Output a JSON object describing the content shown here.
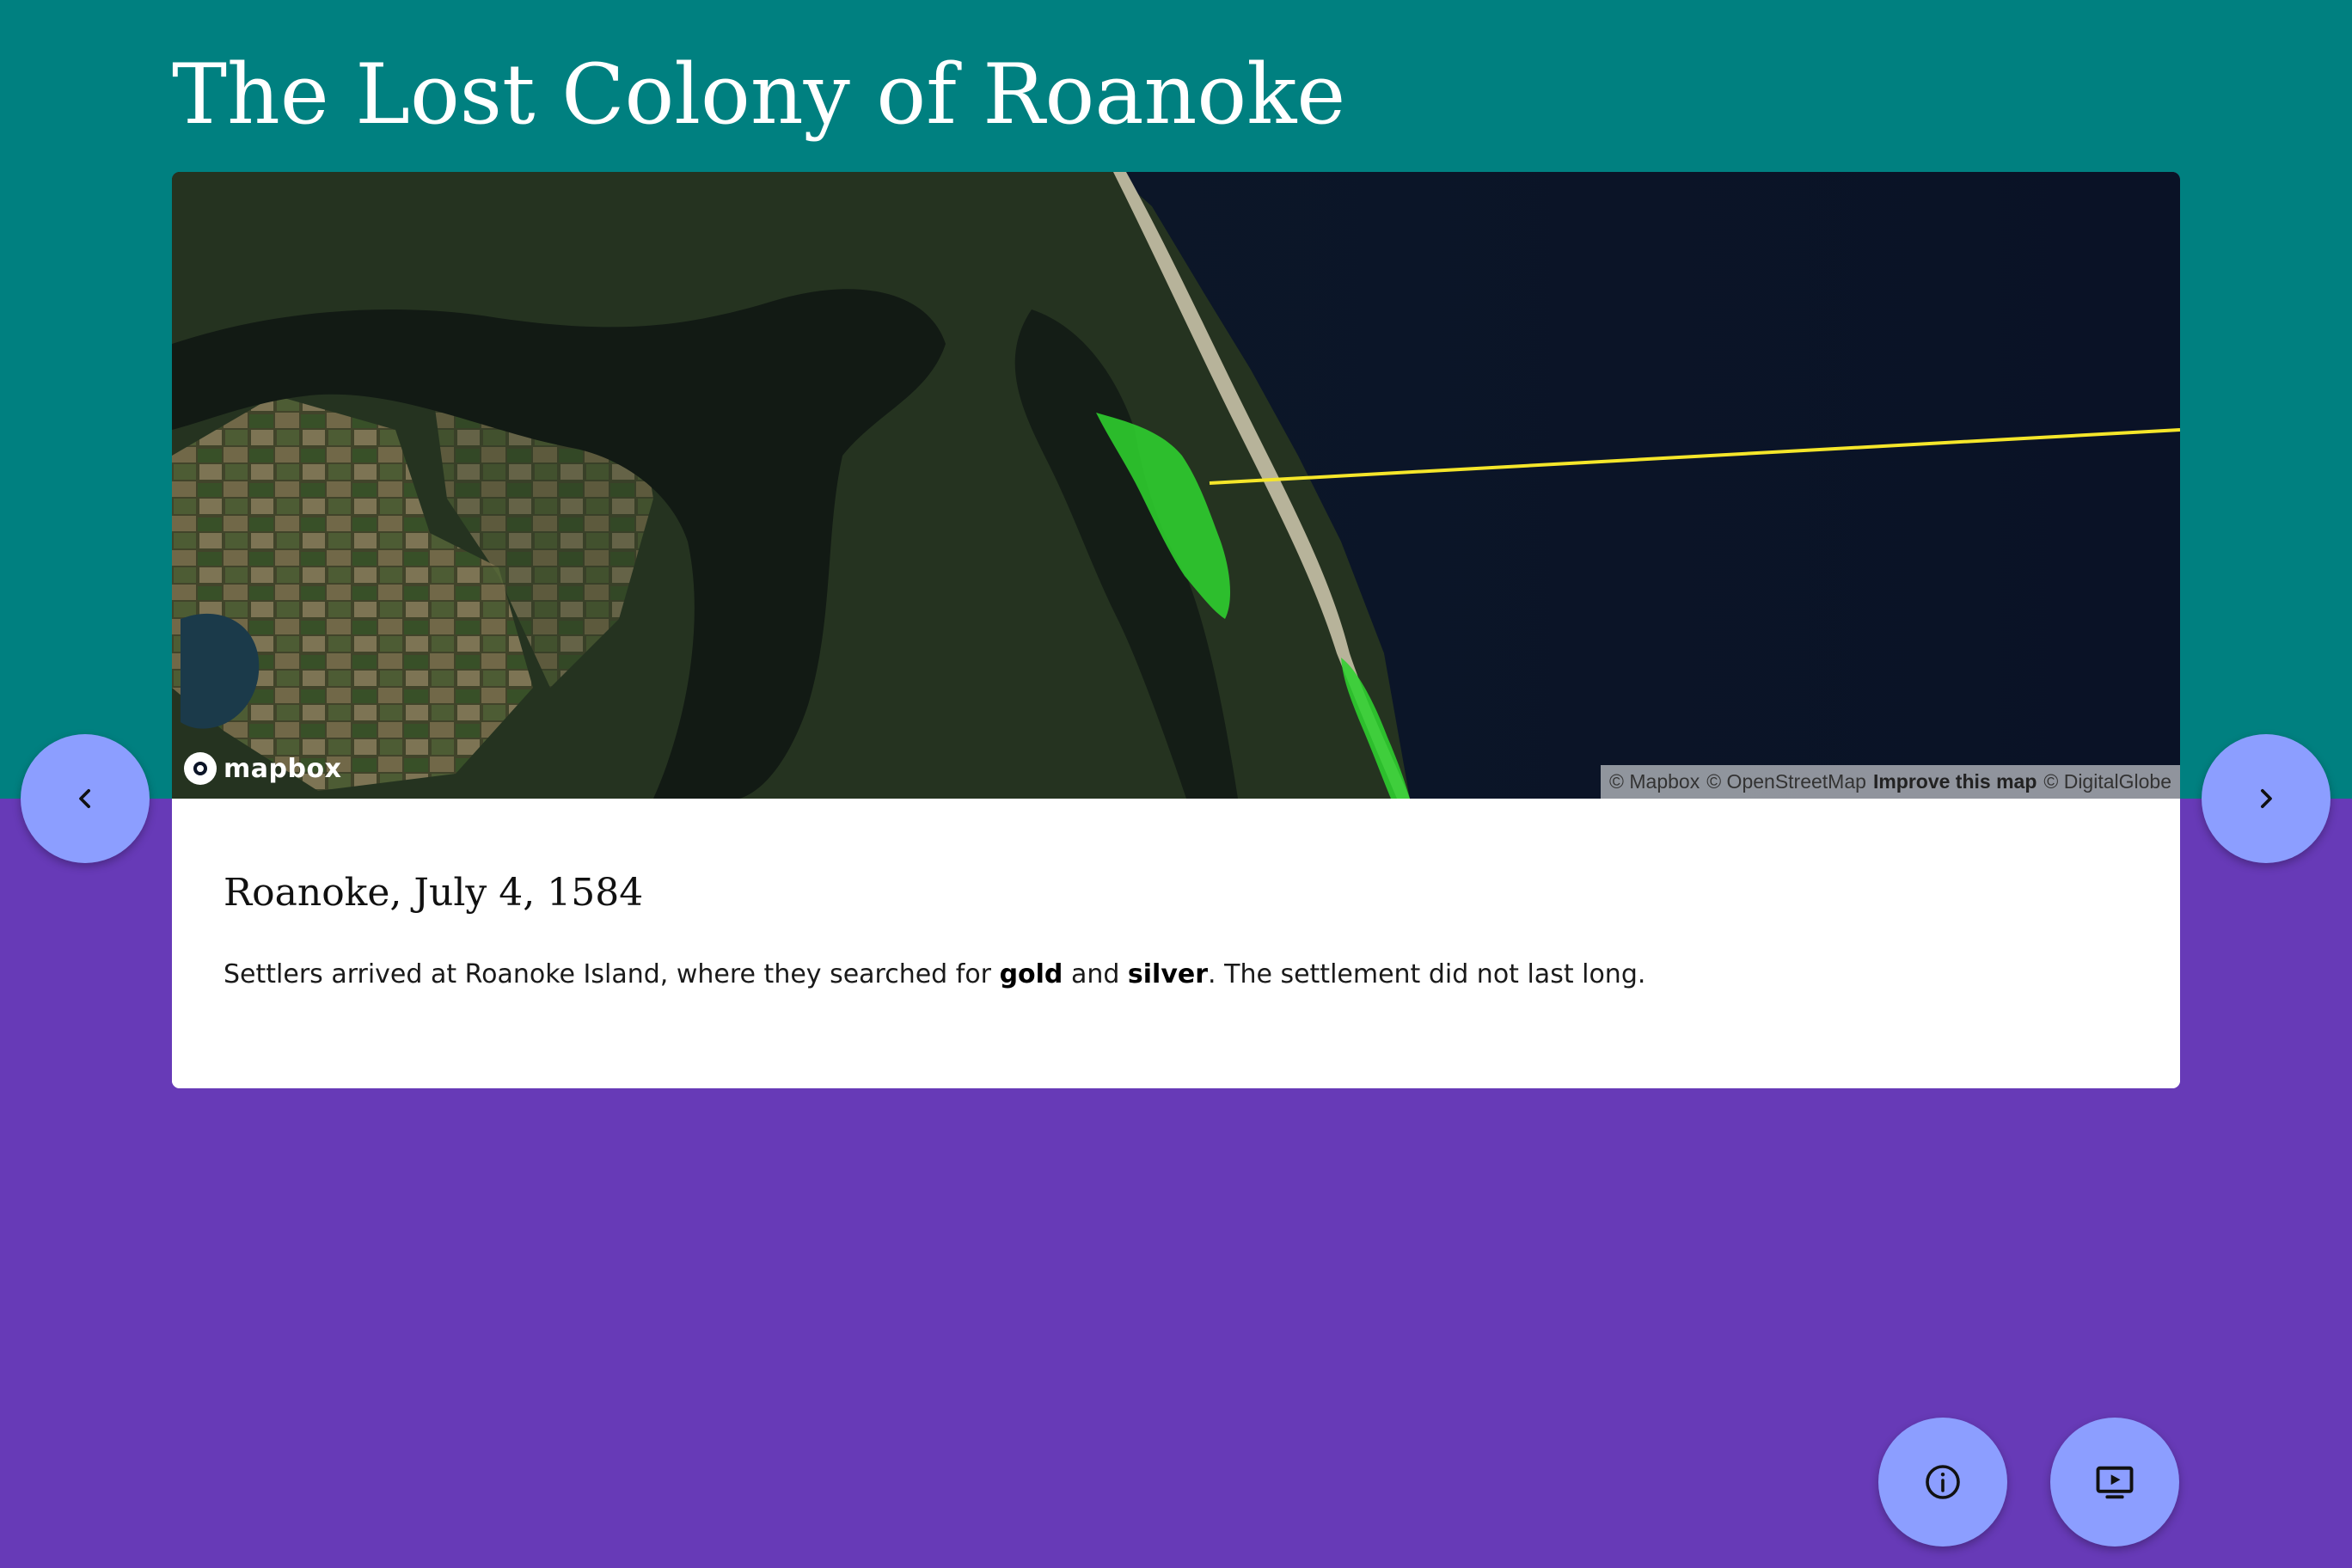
{
  "header": {
    "title": "The Lost Colony of Roanoke"
  },
  "map": {
    "logo_text": "mapbox",
    "attribution": {
      "mapbox": "© Mapbox",
      "osm": "© OpenStreetMap",
      "improve": "Improve this map",
      "digitalglobe": "© DigitalGlobe"
    },
    "colors": {
      "water": "#0b1427",
      "land": "#2c3a22",
      "highlight": "#2fd12f",
      "route_line": "#f5e62a"
    }
  },
  "entry": {
    "title": "Roanoke, July 4, 1584",
    "text_1": "Settlers arrived at Roanoke Island, where they searched for ",
    "bold_1": "gold",
    "text_2": " and ",
    "bold_2": "silver",
    "text_3": ". The settlement did not last long."
  },
  "controls": {
    "prev_icon": "chevron-left-icon",
    "next_icon": "chevron-right-icon",
    "info_icon": "info-icon",
    "present_icon": "slideshow-icon"
  },
  "colors": {
    "header_bg": "#008080",
    "page_bg": "#673ab7",
    "button_bg": "#8c9eff"
  }
}
